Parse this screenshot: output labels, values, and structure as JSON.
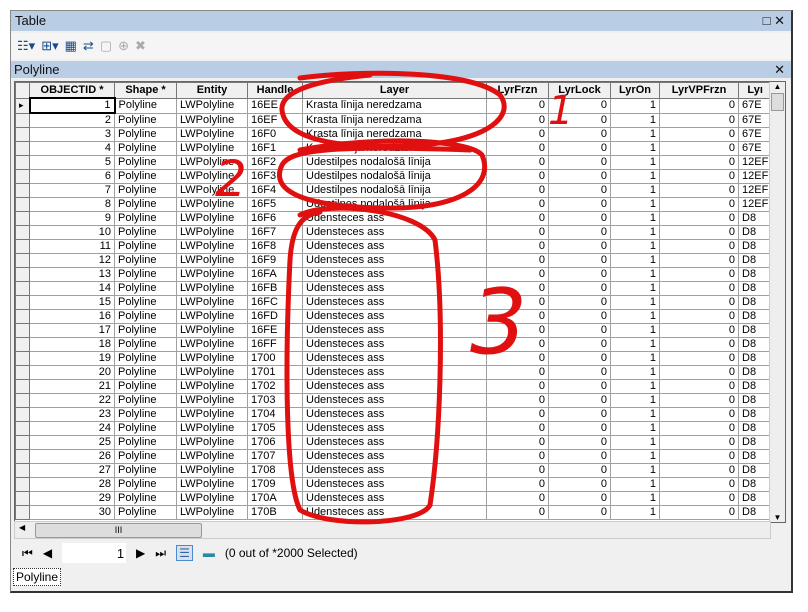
{
  "window": {
    "title": "Table",
    "maximize_icon": "□",
    "close_icon": "✕"
  },
  "toolbar": {
    "icons": [
      "table-options-icon",
      "related-tables-icon",
      "select-by-attributes-icon",
      "switch-selection-icon",
      "clear-selection-icon",
      "zoom-to-selected-icon",
      "delete-selected-icon"
    ]
  },
  "subtable": {
    "title": "Polyline",
    "close_icon": "✕"
  },
  "columns": [
    "OBJECTID *",
    "Shape *",
    "Entity",
    "Handle",
    "Layer",
    "LyrFrzn",
    "LyrLock",
    "LyrOn",
    "LyrVPFrzn",
    "Lyı"
  ],
  "rows": [
    [
      "1",
      "Polyline",
      "LWPolyline",
      "16EE",
      "Krasta līnija neredzama",
      "0",
      "0",
      "1",
      "0",
      "67E"
    ],
    [
      "2",
      "Polyline",
      "LWPolyline",
      "16EF",
      "Krasta līnija neredzama",
      "0",
      "0",
      "1",
      "0",
      "67E"
    ],
    [
      "3",
      "Polyline",
      "LWPolyline",
      "16F0",
      "Krasta līnija neredzama",
      "0",
      "0",
      "1",
      "0",
      "67E"
    ],
    [
      "4",
      "Polyline",
      "LWPolyline",
      "16F1",
      "Krasta līnija neredzama",
      "0",
      "0",
      "1",
      "0",
      "67E"
    ],
    [
      "5",
      "Polyline",
      "LWPolyline",
      "16F2",
      "Ūdestilpes nodalošā līnija",
      "0",
      "0",
      "1",
      "0",
      "12EF"
    ],
    [
      "6",
      "Polyline",
      "LWPolyline",
      "16F3",
      "Ūdestilpes nodalošā līnija",
      "0",
      "0",
      "1",
      "0",
      "12EF"
    ],
    [
      "7",
      "Polyline",
      "LWPolyline",
      "16F4",
      "Ūdestilpes nodalošā līnija",
      "0",
      "0",
      "1",
      "0",
      "12EF"
    ],
    [
      "8",
      "Polyline",
      "LWPolyline",
      "16F5",
      "Ūdestilpes nodalošā līnija",
      "0",
      "0",
      "1",
      "0",
      "12EF"
    ],
    [
      "9",
      "Polyline",
      "LWPolyline",
      "16F6",
      "Ūdensteces ass",
      "0",
      "0",
      "1",
      "0",
      "D8"
    ],
    [
      "10",
      "Polyline",
      "LWPolyline",
      "16F7",
      "Ūdensteces ass",
      "0",
      "0",
      "1",
      "0",
      "D8"
    ],
    [
      "11",
      "Polyline",
      "LWPolyline",
      "16F8",
      "Ūdensteces ass",
      "0",
      "0",
      "1",
      "0",
      "D8"
    ],
    [
      "12",
      "Polyline",
      "LWPolyline",
      "16F9",
      "Ūdensteces ass",
      "0",
      "0",
      "1",
      "0",
      "D8"
    ],
    [
      "13",
      "Polyline",
      "LWPolyline",
      "16FA",
      "Ūdensteces ass",
      "0",
      "0",
      "1",
      "0",
      "D8"
    ],
    [
      "14",
      "Polyline",
      "LWPolyline",
      "16FB",
      "Ūdensteces ass",
      "0",
      "0",
      "1",
      "0",
      "D8"
    ],
    [
      "15",
      "Polyline",
      "LWPolyline",
      "16FC",
      "Ūdensteces ass",
      "0",
      "0",
      "1",
      "0",
      "D8"
    ],
    [
      "16",
      "Polyline",
      "LWPolyline",
      "16FD",
      "Ūdensteces ass",
      "0",
      "0",
      "1",
      "0",
      "D8"
    ],
    [
      "17",
      "Polyline",
      "LWPolyline",
      "16FE",
      "Ūdensteces ass",
      "0",
      "0",
      "1",
      "0",
      "D8"
    ],
    [
      "18",
      "Polyline",
      "LWPolyline",
      "16FF",
      "Ūdensteces ass",
      "0",
      "0",
      "1",
      "0",
      "D8"
    ],
    [
      "19",
      "Polyline",
      "LWPolyline",
      "1700",
      "Ūdensteces ass",
      "0",
      "0",
      "1",
      "0",
      "D8"
    ],
    [
      "20",
      "Polyline",
      "LWPolyline",
      "1701",
      "Ūdensteces ass",
      "0",
      "0",
      "1",
      "0",
      "D8"
    ],
    [
      "21",
      "Polyline",
      "LWPolyline",
      "1702",
      "Ūdensteces ass",
      "0",
      "0",
      "1",
      "0",
      "D8"
    ],
    [
      "22",
      "Polyline",
      "LWPolyline",
      "1703",
      "Ūdensteces ass",
      "0",
      "0",
      "1",
      "0",
      "D8"
    ],
    [
      "23",
      "Polyline",
      "LWPolyline",
      "1704",
      "Ūdensteces ass",
      "0",
      "0",
      "1",
      "0",
      "D8"
    ],
    [
      "24",
      "Polyline",
      "LWPolyline",
      "1705",
      "Ūdensteces ass",
      "0",
      "0",
      "1",
      "0",
      "D8"
    ],
    [
      "25",
      "Polyline",
      "LWPolyline",
      "1706",
      "Ūdensteces ass",
      "0",
      "0",
      "1",
      "0",
      "D8"
    ],
    [
      "26",
      "Polyline",
      "LWPolyline",
      "1707",
      "Ūdensteces ass",
      "0",
      "0",
      "1",
      "0",
      "D8"
    ],
    [
      "27",
      "Polyline",
      "LWPolyline",
      "1708",
      "Ūdensteces ass",
      "0",
      "0",
      "1",
      "0",
      "D8"
    ],
    [
      "28",
      "Polyline",
      "LWPolyline",
      "1709",
      "Ūdensteces ass",
      "0",
      "0",
      "1",
      "0",
      "D8"
    ],
    [
      "29",
      "Polyline",
      "LWPolyline",
      "170A",
      "Ūdensteces ass",
      "0",
      "0",
      "1",
      "0",
      "D8"
    ],
    [
      "30",
      "Polyline",
      "LWPolyline",
      "170B",
      "Ūdensteces ass",
      "0",
      "0",
      "1",
      "0",
      "D8"
    ]
  ],
  "nav": {
    "first": "⏮",
    "prev": "◀",
    "record": "1",
    "next": "▶",
    "last": "⏭",
    "status": "(0 out of *2000 Selected)"
  },
  "hscroll_thumb": "III",
  "tab": {
    "label": "Polyline"
  },
  "annotations": {
    "color": "#e01010",
    "labels": [
      "1",
      "2",
      "3"
    ]
  }
}
